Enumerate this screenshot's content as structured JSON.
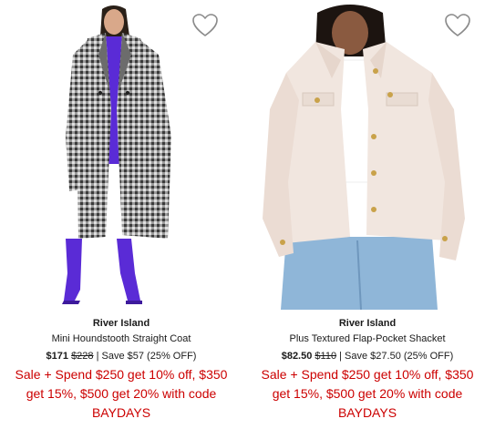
{
  "products": [
    {
      "brand": "River Island",
      "name": "Mini Houndstooth Straight Coat",
      "sale_price": "$171",
      "original_price": "$228",
      "savings": "| Save $57 (25% OFF)",
      "promo_line1": "Sale + Spend $250 get 10% off, $350",
      "promo_line2": "get 15%, $500 get 20% with code",
      "promo_code": "BAYDAYS",
      "wishlist_icon": "heart-outline-icon"
    },
    {
      "brand": "River Island",
      "name": "Plus Textured Flap-Pocket Shacket",
      "sale_price": "$82.50",
      "original_price": "$110",
      "savings": "| Save $27.50 (25% OFF)",
      "promo_line1": "Sale + Spend $250 get 10% off, $350",
      "promo_line2": "get 15%, $500 get 20% with code",
      "promo_code": "BAYDAYS",
      "wishlist_icon": "heart-outline-icon"
    }
  ],
  "colors": {
    "promo_red": "#cc0000",
    "text": "#1a1a1a",
    "coat_purple": "#5a2bd6"
  }
}
